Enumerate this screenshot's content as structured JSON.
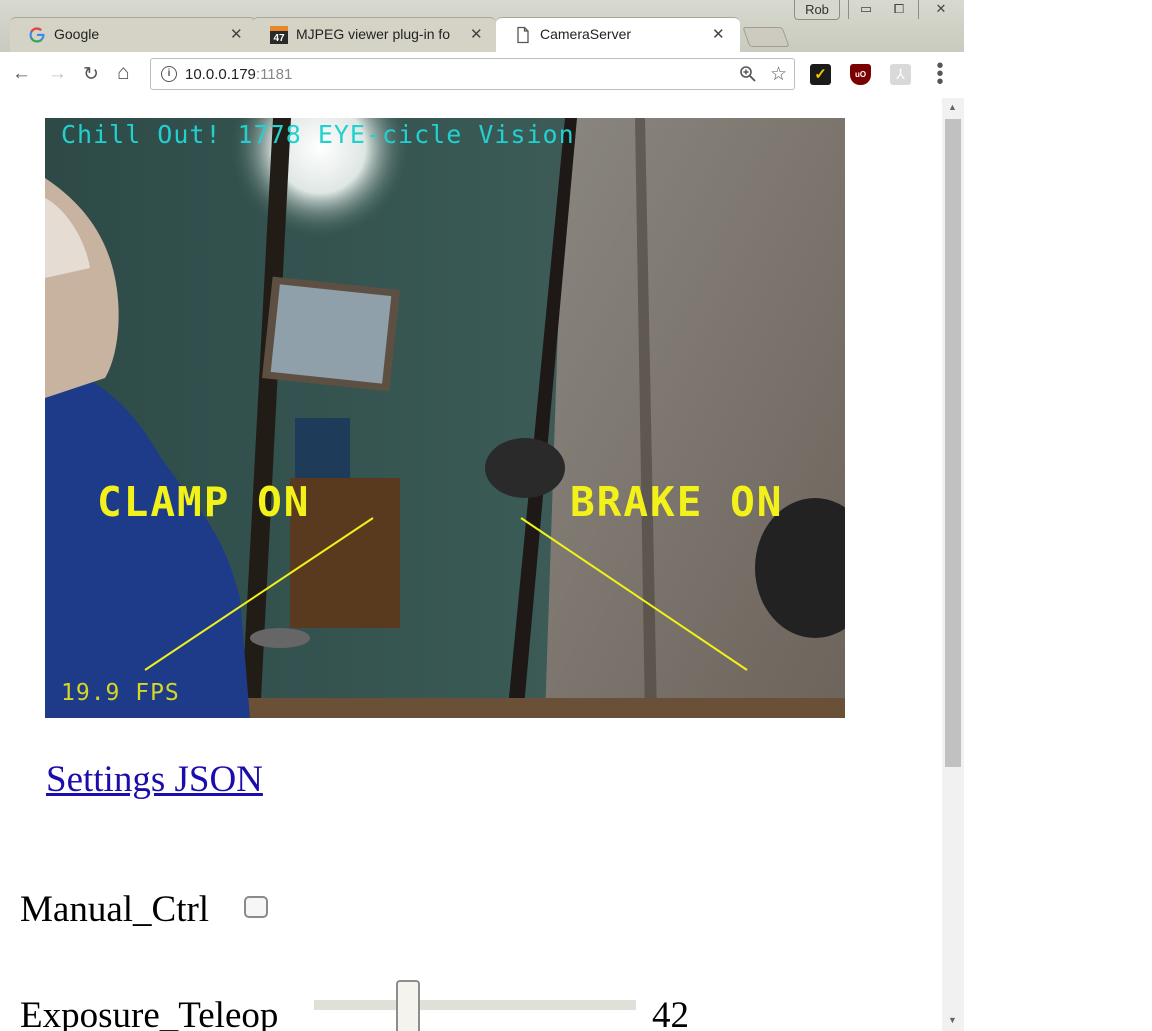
{
  "window": {
    "profile_name": "Rob",
    "controls": {
      "minimize": "▭",
      "maximize": "⧠",
      "close": "✕"
    }
  },
  "tabs": [
    {
      "title": "Google",
      "icon": "google-g-icon",
      "active": false
    },
    {
      "title": "MJPEG viewer plug-in fo",
      "icon": "site-47-icon",
      "active": false
    },
    {
      "title": "CameraServer",
      "icon": "page-icon",
      "active": true
    }
  ],
  "toolbar": {
    "url_host": "10.0.0.179",
    "url_port": ":1181",
    "back": "←",
    "forward": "→",
    "reload": "↻",
    "home": "⌂",
    "zoom": "🔍",
    "bookmark": "☆"
  },
  "content": {
    "camera": {
      "banner": "Chill Out! 1778 EYE-cicle Vision",
      "fps": "19.9 FPS",
      "clamp": "CLAMP ON",
      "brake": "BRAKE ON"
    },
    "settings_link": "Settings JSON",
    "manual_ctrl_label": "Manual_Ctrl",
    "manual_ctrl_checked": false,
    "exposure_label": "Exposure_Teleop",
    "exposure_value": "42"
  },
  "colors": {
    "link": "#1a0dab",
    "overlay_yellow": "#f2f21a",
    "overlay_cyan": "#22d0d0"
  }
}
